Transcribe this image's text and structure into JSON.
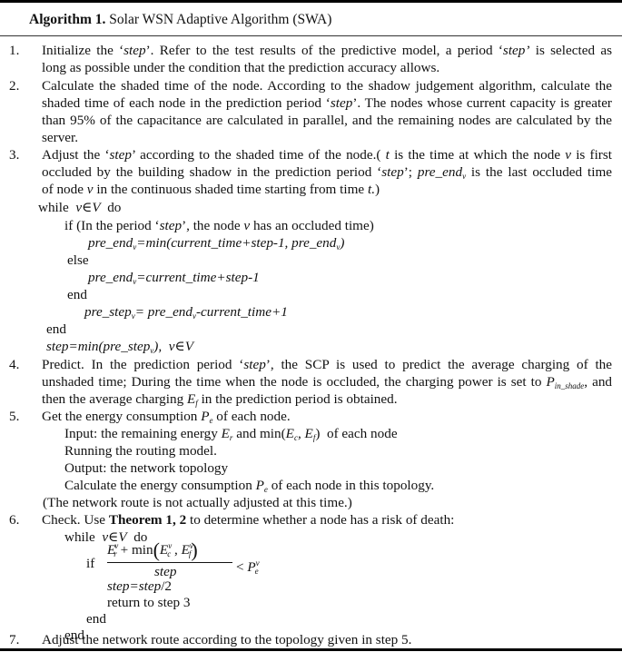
{
  "title": {
    "label": "Algorithm 1.",
    "name": "Solar WSN Adaptive Algorithm (SWA)"
  },
  "steps": [
    {
      "num": "1.",
      "lines": [
        "Initialize the ‘step’. Refer to the test results of the predictive model, a period ‘step’ is selected as",
        "long as possible under the condition that the prediction accuracy allows."
      ]
    },
    {
      "num": "2.",
      "lines": [
        "Calculate the shaded time of the node. According to the shadow judgement algorithm, calculate the",
        "shaded time of each node in the prediction period ‘step’. The nodes whose current capacity is greater",
        "than 95% of the capacitance are calculated in parallel, and the remaining nodes are calculated by the",
        "server."
      ]
    },
    {
      "num": "3.",
      "lines": [
        "Adjust the ‘step’ according to the shaded time of the node.( t is the time at which the node v is first",
        "occluded by the building shadow in the prediction period ‘step’; pre_endv is the last occluded time",
        "of node v in the continuous shaded time starting from time t.)"
      ],
      "code": {
        "while_kw": "while",
        "loop_cond": "v∈V",
        "do_kw": "do",
        "if_line": "if (In the period ‘step’, the node v has an occluded time)",
        "assign1": "pre_endv=min(current_time+step-1, pre_endv)",
        "else_kw": "else",
        "assign2": "pre_endv=current_time+step-1",
        "end_kw": "end",
        "assign3": "pre_stepv= pre_endv-current_time+1",
        "end_kw2": "end",
        "final": "step=min(pre_stepv),  v∈V"
      }
    },
    {
      "num": "4.",
      "lines": [
        "Predict. In the prediction period ‘step’, the SCP is used to predict the average charging of the",
        "unshaded time; During the time when the node is occluded, the charging power is set to Pin_shade, and",
        "then the average charging Ef in the prediction period is obtained."
      ]
    },
    {
      "num": "5.",
      "lines": [
        "Get the energy consumption Pe of each node."
      ],
      "sub_lines": [
        "Input: the remaining energy Er and min(Ec, Ef) of each node",
        "Running the routing model.",
        "Output: the network topology",
        "Calculate the energy consumption Pe of each node in this topology."
      ],
      "note": "(The network route is not actually adjusted at this time.)"
    },
    {
      "num": "6.",
      "lines": [
        "Check. Use Theorem 1, 2 to determine whether a node has a risk of death:"
      ],
      "code": {
        "while_kw": "while",
        "loop_cond": "v∈V",
        "do_kw": "do",
        "if_kw": "if",
        "frac_num": "Erv + min(Ecv, Efv)",
        "frac_den": "step",
        "compare": "< Pev",
        "assign": "step=step/2",
        "return": "return to step 3",
        "end_kw": "end",
        "end_kw2": "end"
      }
    },
    {
      "num": "7.",
      "lines": [
        "Adjust the network route according to the topology given in step 5."
      ]
    }
  ]
}
